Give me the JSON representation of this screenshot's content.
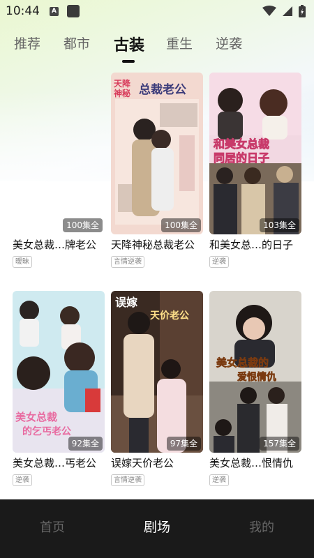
{
  "status_bar": {
    "time": "10:44",
    "a_label": "A",
    "icons": [
      "notification-a-icon",
      "app-square-icon",
      "wifi-icon",
      "signal-icon",
      "battery-icon"
    ]
  },
  "tabs": [
    {
      "label": "推荐",
      "active": false
    },
    {
      "label": "都市",
      "active": false
    },
    {
      "label": "古装",
      "active": true
    },
    {
      "label": "重生",
      "active": false
    },
    {
      "label": "逆袭",
      "active": false
    }
  ],
  "cards": [
    {
      "title": "美女总裁…牌老公",
      "episodes": "100集全",
      "tag": "暧昧",
      "poster_text": ""
    },
    {
      "title": "天降神秘总裁老公",
      "episodes": "100集全",
      "tag": "言情逆袭",
      "poster_text_a": "天降",
      "poster_text_b": "神秘",
      "poster_text_c": "总裁老公"
    },
    {
      "title": "和美女总…的日子",
      "episodes": "103集全",
      "tag": "逆袭",
      "poster_text_a": "和美女总裁",
      "poster_text_b": "同居的日子"
    },
    {
      "title": "美女总裁…丐老公",
      "episodes": "92集全",
      "tag": "逆袭",
      "poster_text_a": "美女总裁",
      "poster_text_b": "的乞丐老公"
    },
    {
      "title": "误嫁天价老公",
      "episodes": "97集全",
      "tag": "言情逆袭",
      "poster_text_a": "误嫁",
      "poster_text_b": "天价老公"
    },
    {
      "title": "美女总裁…恨情仇",
      "episodes": "157集全",
      "tag": "逆袭",
      "poster_text_a": "美女总裁的",
      "poster_text_b": "爱恨情仇"
    }
  ],
  "bottom_nav": [
    {
      "label": "首页",
      "active": false
    },
    {
      "label": "剧场",
      "active": true
    },
    {
      "label": "我的",
      "active": false
    }
  ],
  "colors": {
    "active_tab": "#111111",
    "inactive_tab": "#666666",
    "nav_bg": "#1a1a1a",
    "nav_active": "#ffffff",
    "nav_inactive": "#666666"
  }
}
